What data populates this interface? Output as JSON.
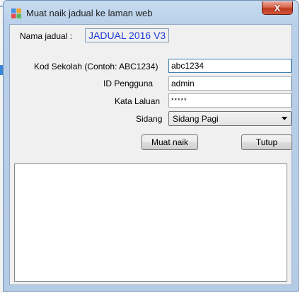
{
  "window": {
    "title": "Muat naik jadual ke laman web",
    "close_symbol": "X",
    "icon": "app-windows-icon"
  },
  "form": {
    "name_label": "Nama jadual :",
    "name_value": "JADUAL 2016 V3",
    "school_code_label": "Kod Sekolah (Contoh: ABC1234)",
    "school_code_value": "abc1234",
    "user_id_label": "ID Pengguna",
    "user_id_value": "admin",
    "password_label": "Kata Laluan",
    "password_value": "*****",
    "session_label": "Sidang",
    "session_value": "Sidang Pagi"
  },
  "buttons": {
    "upload_label": "Muat naik",
    "close_label": "Tutup"
  },
  "output": {
    "text": ""
  }
}
